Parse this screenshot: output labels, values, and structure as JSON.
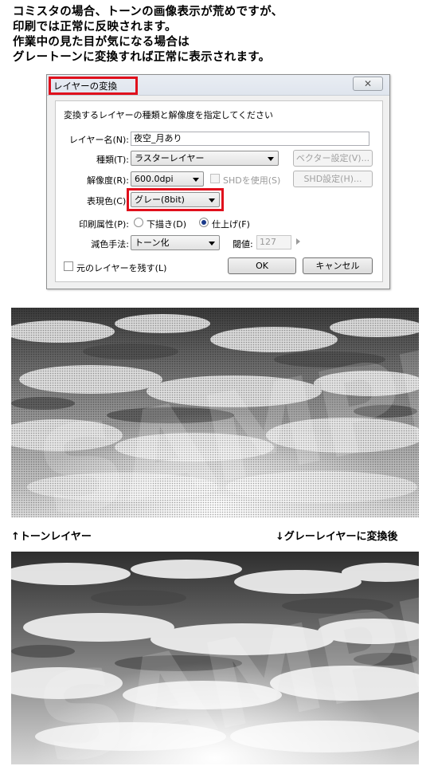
{
  "intro": {
    "lines": [
      "コミスタの場合、トーンの画像表示が荒めですが、",
      "印刷では正常に反映されます。",
      "作業中の見た目が気になる場合は",
      "グレートーンに変換すれば正常に表示されます。"
    ]
  },
  "dialog": {
    "title": "レイヤーの変換",
    "close_icon": "close-icon",
    "instruction": "変換するレイヤーの種類と解像度を指定してください",
    "layer_name_label": "レイヤー名(N):",
    "layer_name_value": "夜空_月あり",
    "type_label": "種類(T):",
    "type_value": "ラスターレイヤー",
    "vector_settings_button": "ベクター設定(V)...",
    "resolution_label": "解像度(R):",
    "resolution_value": "600.0dpi",
    "use_shd_label": "SHDを使用(S)",
    "shd_settings_button": "SHD設定(H)...",
    "color_label": "表現色(C):",
    "color_value": "グレー(8bit)",
    "print_attr_label": "印刷属性(P):",
    "print_draft_label": "下描き(D)",
    "print_final_label": "仕上げ(F)",
    "print_selected": "仕上げ(F)",
    "reduction_label": "減色手法:",
    "reduction_value": "トーン化",
    "threshold_label": "閾値:",
    "threshold_value": "127",
    "keep_original_label": "元のレイヤーを残す(L)",
    "ok_button": "OK",
    "cancel_button": "キャンセル"
  },
  "captions": {
    "tone_layer": "↑トーンレイヤー",
    "gray_layer": "↓グレーレイヤーに変換後"
  },
  "watermark": "SAMPLE",
  "colors": {
    "highlight_red": "#e0101c",
    "dialog_bg": "#f0f0f0"
  }
}
